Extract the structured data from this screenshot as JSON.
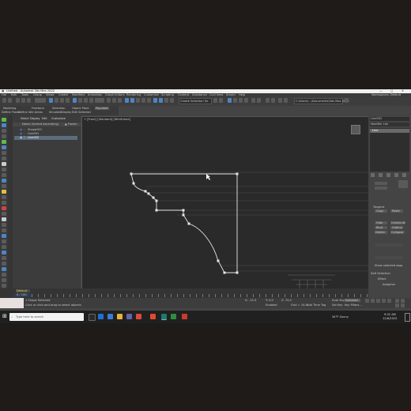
{
  "app": {
    "title": "Untitled - Autodesk 3ds Max 2022",
    "workspace": "Workspaces: Default"
  },
  "menu": [
    "File",
    "Edit",
    "Tools",
    "Group",
    "Views",
    "Create",
    "Modifiers",
    "Animation",
    "Graph Editors",
    "Rendering",
    "Customize",
    "Scripting",
    "Content",
    "Substance",
    "Civil View",
    "Arnold",
    "Help"
  ],
  "toolbar": {
    "selection_set": "Create Selection Se",
    "path": "C:\\Users\\...\\Documents\\3ds Max 2022"
  },
  "ribbon": {
    "tabs": [
      "Modeling",
      "Freeform",
      "Selection",
      "Object Paint",
      "Populate"
    ],
    "subitems": [
      "Define Flows",
      "Define Idle Areas",
      "Simulate",
      "Display",
      "Edit Selected"
    ]
  },
  "explorer": {
    "tabs": [
      "Select",
      "Display",
      "Edit",
      "Customize"
    ],
    "column_header": "Name (Sorted Ascending)",
    "frozen_header": "▲ Frozen",
    "items": [
      "Shape001",
      "Line001",
      "Line002"
    ]
  },
  "viewport": {
    "label": "+ [Front] [Standard] [Wireframe]"
  },
  "cmd": {
    "object_name": "Line002",
    "modifier_list": "Modifier List",
    "stack_item": "Line",
    "tangent": "Tangent",
    "copy": "Copy",
    "paste": "Paste",
    "hide": "Hide",
    "unhide_all": "Unhide All",
    "bind": "Bind",
    "unbind": "Unbind",
    "delete": "Delete",
    "collapse": "Collapse",
    "show_selected_segs": "Show selected segs",
    "soft_selection": "Soft Selection",
    "affect": "Effect",
    "adaptive": "Adaptive"
  },
  "timeline": {
    "layer": "Default",
    "frame_counter": "0 / 100"
  },
  "status": {
    "line1": "1 Shape Selected",
    "line2": "Click or click-and-drag to select objects",
    "x": "X: -13.3",
    "y": "Y: 0.0",
    "z": "Z: 74.0",
    "grid": "Grid = 10.0",
    "auto_key": "Auto Key",
    "set_key": "Set Key",
    "selected": "Selected",
    "key_filters": "Key Filters...",
    "add_time_tag": "Add Time Tag",
    "enabled": "Enabled"
  },
  "taskbar": {
    "search_placeholder": "Type here to search",
    "weather": "34°F  Sunny",
    "time": "9:02 AM",
    "date": "12/6/2022"
  },
  "colors": {
    "accent_blue": "#4e86c4",
    "spline_white": "#e6e6e6",
    "selected_yellow": "#e0c043",
    "viewport_bg": "#2a2a2a"
  }
}
